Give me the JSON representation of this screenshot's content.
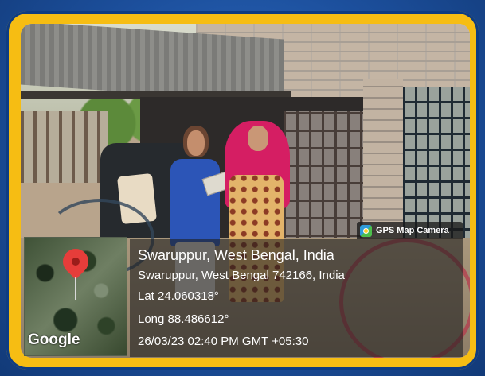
{
  "overlay": {
    "app_label": "GPS Map Camera",
    "place_title": "Swaruppur, West Bengal, India",
    "address": "Swaruppur, West Bengal 742166, India",
    "lat": "Lat 24.060318°",
    "long": "Long 88.486612°",
    "datetime": "26/03/23 02:40 PM GMT +05:30"
  },
  "map": {
    "attribution": "Google",
    "pin_icon": "map-pin-icon"
  },
  "colors": {
    "frame": "#f6bd13",
    "background": "#1c4f9c",
    "pin": "#e63d3a"
  }
}
